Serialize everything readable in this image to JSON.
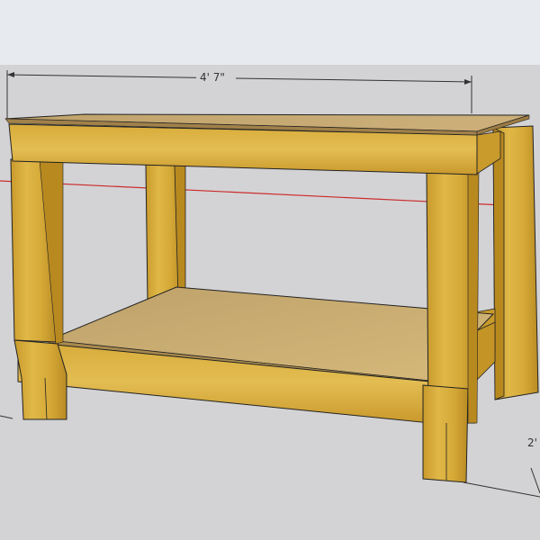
{
  "viewport": {
    "sky_color": "#e7eaee",
    "ground_color": "#d3d3d5",
    "wood_color": "#d9ad38",
    "wood_dark": "#a8801f",
    "shelf_color": "#c9ab6a",
    "axis_color": "#cc2b2b"
  },
  "dimensions": {
    "width_label": "4' 7\"",
    "depth_label": "2'"
  },
  "model": {
    "object": "workbench",
    "icon": "workbench-3d-model"
  }
}
